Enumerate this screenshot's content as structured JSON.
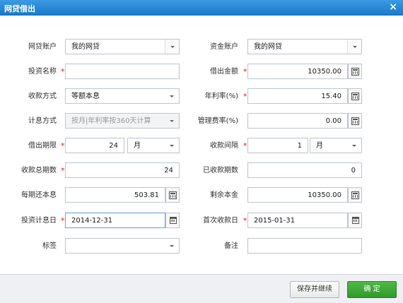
{
  "dialog": {
    "title": "网贷借出",
    "close_icon": "×"
  },
  "fields": {
    "loan_account": {
      "label": "网贷账户",
      "value": "我的网贷"
    },
    "fund_account": {
      "label": "资金账户",
      "value": "我的网贷"
    },
    "investment_name": {
      "label": "投资名称",
      "value": ""
    },
    "lend_amount": {
      "label": "借出金额",
      "value": "10350.00"
    },
    "repayment_method": {
      "label": "收款方式",
      "value": "等额本息"
    },
    "annual_rate": {
      "label": "年利率(%)",
      "value": "15.40"
    },
    "interest_method": {
      "label": "计息方式",
      "value": "按月|年利率按360天计算"
    },
    "management_fee_rate": {
      "label": "管理费率(%)",
      "value": "0.00"
    },
    "lend_term": {
      "label": "借出期限",
      "value": "24",
      "unit": "月"
    },
    "repayment_interval": {
      "label": "收款间隔",
      "value": "1",
      "unit": "月"
    },
    "total_periods": {
      "label": "收款总期数",
      "value": "24"
    },
    "received_periods": {
      "label": "已收款期数",
      "value": "0"
    },
    "periodic_repayment": {
      "label": "每期还本息",
      "value": "503.81"
    },
    "remaining_principal": {
      "label": "剩余本金",
      "value": "10350.00"
    },
    "interest_start_date": {
      "label": "投资计息日",
      "value": "2014-12-31"
    },
    "first_repayment_date": {
      "label": "首次收款日",
      "value": "2015-01-31"
    },
    "tag": {
      "label": "标签",
      "value": ""
    },
    "remark": {
      "label": "备注",
      "value": ""
    }
  },
  "required_mark": "*",
  "buttons": {
    "save_continue": "保存并继续",
    "confirm": "确 定"
  },
  "colors": {
    "titlebar": "#2a86d6",
    "required": "#e02020",
    "confirm": "#3aa835"
  }
}
